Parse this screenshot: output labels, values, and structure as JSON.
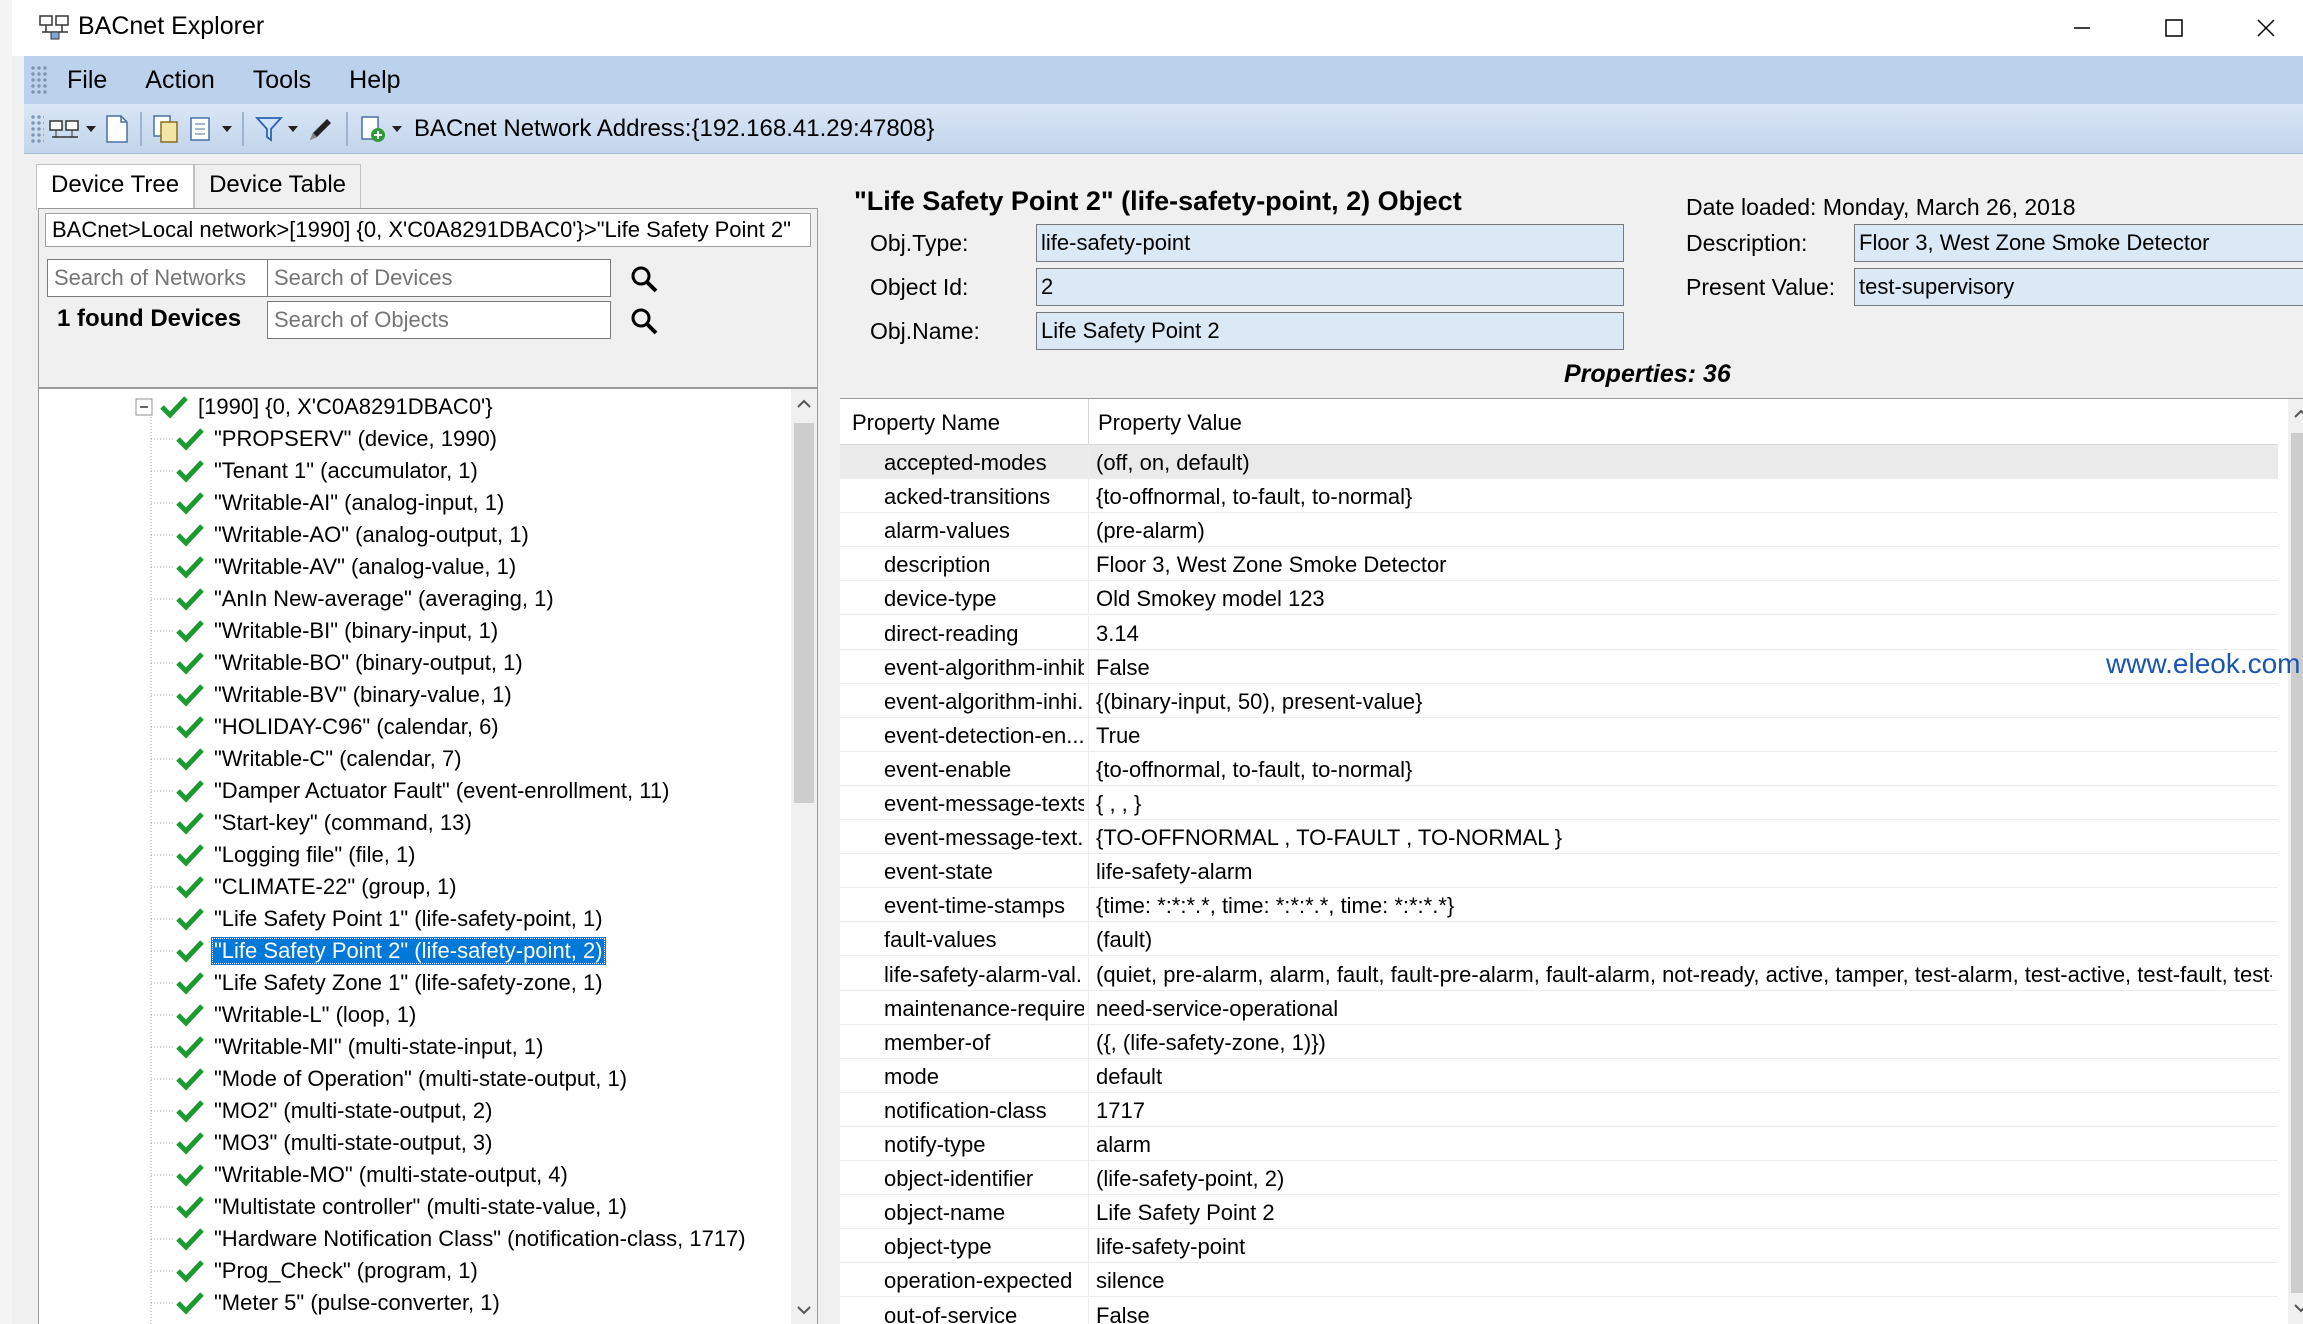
{
  "window": {
    "title": "BACnet Explorer"
  },
  "menu": [
    "File",
    "Action",
    "Tools",
    "Help"
  ],
  "toolbar": {
    "network_address": "BACnet Network Address:{192.168.41.29:47808}"
  },
  "left": {
    "tabs": [
      "Device Tree",
      "Device Table"
    ],
    "breadcrumb": "BACnet>Local network>[1990] {0, X'C0A8291DBAC0'}>\"Life Safety Point 2\"",
    "search_networks_placeholder": "Search of Networks",
    "search_devices_placeholder": "Search of Devices",
    "search_objects_placeholder": "Search of Objects",
    "found_text": "1 found Devices",
    "tree_root": "[1990] {0, X'C0A8291DBAC0'}",
    "tree_items": [
      "\"PROPSERV\" (device, 1990)",
      "\"Tenant 1\" (accumulator, 1)",
      "\"Writable-AI\" (analog-input, 1)",
      "\"Writable-AO\" (analog-output, 1)",
      "\"Writable-AV\" (analog-value, 1)",
      "\"AnIn New-average\" (averaging, 1)",
      "\"Writable-BI\" (binary-input, 1)",
      "\"Writable-BO\" (binary-output, 1)",
      "\"Writable-BV\" (binary-value, 1)",
      "\"HOLIDAY-C96\" (calendar, 6)",
      "\"Writable-C\" (calendar, 7)",
      "\"Damper Actuator Fault\" (event-enrollment, 11)",
      "\"Start-key\" (command, 13)",
      "\"Logging file\" (file, 1)",
      "\"CLIMATE-22\" (group, 1)",
      "\"Life Safety Point 1\" (life-safety-point, 1)",
      "\"Life Safety Point 2\" (life-safety-point, 2)",
      "\"Life Safety Zone 1\" (life-safety-zone, 1)",
      "\"Writable-L\" (loop, 1)",
      "\"Writable-MI\" (multi-state-input, 1)",
      "\"Mode of Operation\" (multi-state-output, 1)",
      "\"MO2\" (multi-state-output, 2)",
      "\"MO3\" (multi-state-output, 3)",
      "\"Writable-MO\" (multi-state-output, 4)",
      "\"Multistate controller\" (multi-state-value, 1)",
      "\"Hardware Notification Class\" (notification-class, 1717)",
      "\"Prog_Check\" (program, 1)",
      "\"Meter 5\" (pulse-converter, 1)"
    ]
  },
  "right": {
    "object_title": "\"Life Safety Point 2\" (life-safety-point, 2) Object",
    "obj_type_label": "Obj.Type:",
    "obj_type": "life-safety-point",
    "object_id_label": "Object Id:",
    "object_id": "2",
    "obj_name_label": "Obj.Name:",
    "obj_name": "Life Safety Point 2",
    "date_loaded": "Date loaded: Monday, March 26, 2018",
    "description_label": "Description:",
    "description": "Floor 3, West Zone Smoke Detector",
    "present_value_label": "Present Value:",
    "present_value": "test-supervisory",
    "properties_count": "Properties: 36",
    "grid_header": {
      "name": "Property Name",
      "value": "Property Value"
    },
    "properties": [
      [
        "accepted-modes",
        "(off, on, default)"
      ],
      [
        "acked-transitions",
        "{to-offnormal, to-fault, to-normal}"
      ],
      [
        "alarm-values",
        "(pre-alarm)"
      ],
      [
        "description",
        "Floor 3, West Zone Smoke Detector"
      ],
      [
        "device-type",
        "Old Smokey model 123"
      ],
      [
        "direct-reading",
        "3.14"
      ],
      [
        "event-algorithm-inhibit",
        "False"
      ],
      [
        "event-algorithm-inhi...",
        "{(binary-input, 50), present-value}"
      ],
      [
        "event-detection-en...",
        "True"
      ],
      [
        "event-enable",
        "{to-offnormal, to-fault, to-normal}"
      ],
      [
        "event-message-texts",
        "{ , , }"
      ],
      [
        "event-message-text...",
        "{TO-OFFNORMAL , TO-FAULT , TO-NORMAL }"
      ],
      [
        "event-state",
        "life-safety-alarm"
      ],
      [
        "event-time-stamps",
        "{time: *:*:*.*, time: *:*:*.*, time: *:*:*.*}"
      ],
      [
        "fault-values",
        "(fault)"
      ],
      [
        "life-safety-alarm-val...",
        "(quiet, pre-alarm, alarm, fault, fault-pre-alarm, fault-alarm, not-ready, active, tamper, test-alarm, test-active, test-fault, test-fa..."
      ],
      [
        "maintenance-required",
        "need-service-operational"
      ],
      [
        "member-of",
        "({, (life-safety-zone, 1)})"
      ],
      [
        "mode",
        "default"
      ],
      [
        "notification-class",
        "1717"
      ],
      [
        "notify-type",
        "alarm"
      ],
      [
        "object-identifier",
        "(life-safety-point, 2)"
      ],
      [
        "object-name",
        "Life Safety Point 2"
      ],
      [
        "object-type",
        "life-safety-point"
      ],
      [
        "operation-expected",
        "silence"
      ],
      [
        "out-of-service",
        "False"
      ]
    ]
  },
  "watermark": "www.eleok.com",
  "colors": {
    "menubar": "#bcd2ec",
    "selection": "#0078d7",
    "check": "#1d9a2f",
    "field_bg": "#dbe8f5"
  }
}
